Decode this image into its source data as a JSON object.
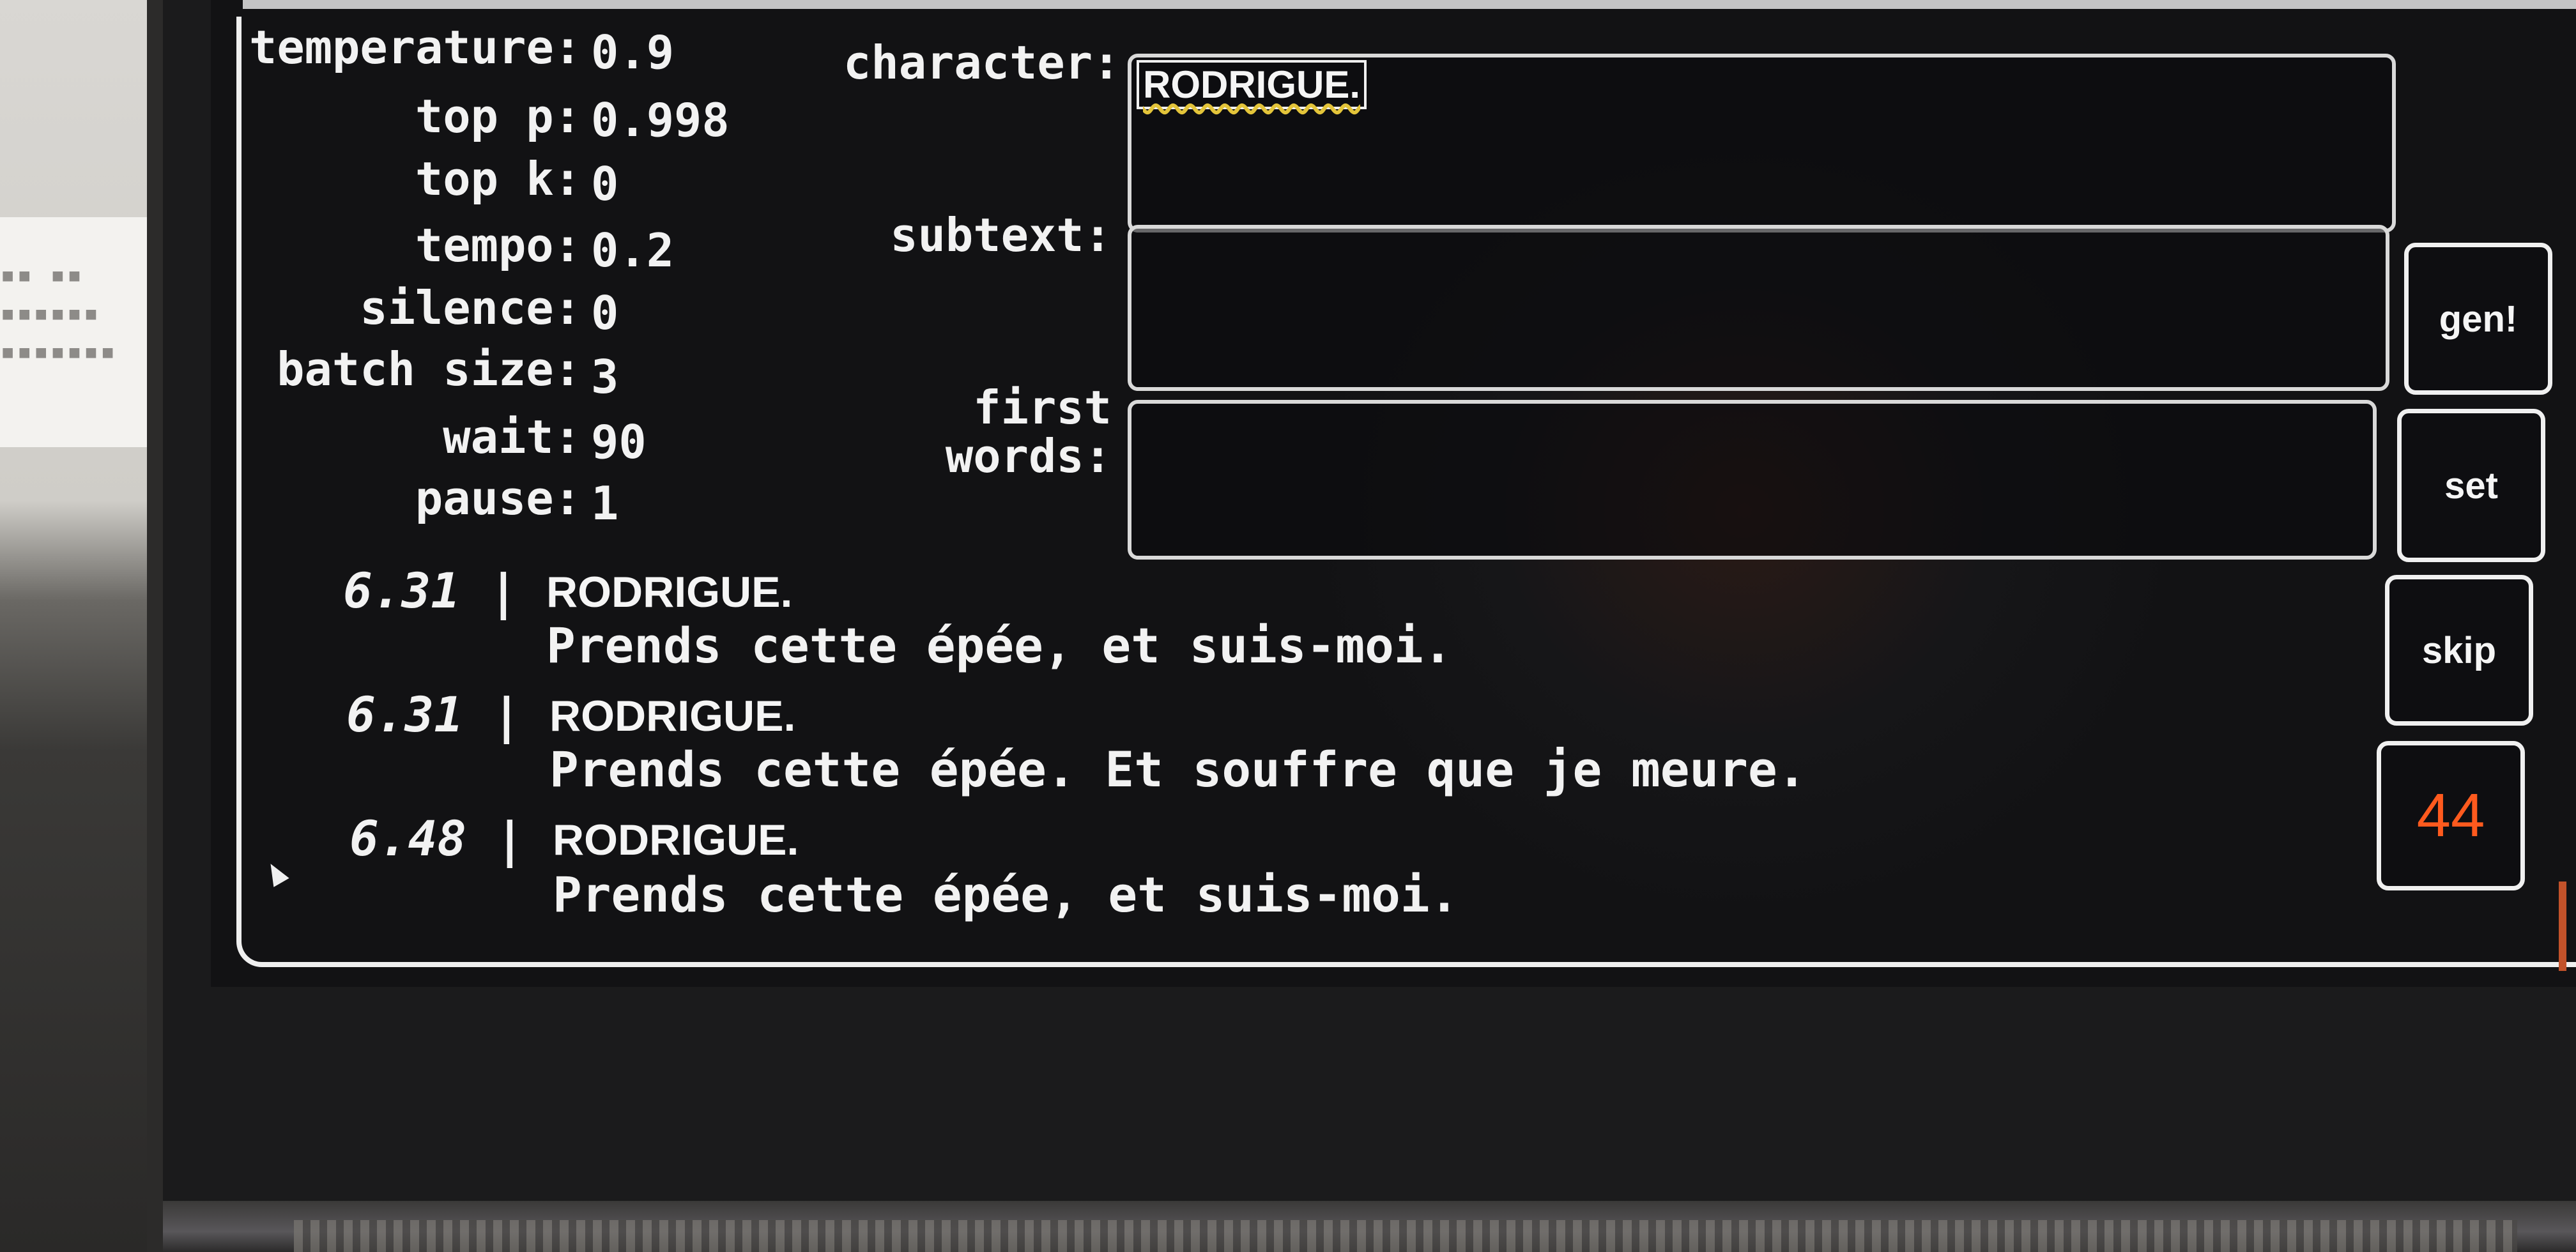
{
  "params": [
    {
      "label": "temperature:",
      "value": "0.9"
    },
    {
      "label": "top p:",
      "value": "0.998"
    },
    {
      "label": "top k:",
      "value": "0"
    },
    {
      "label": "tempo:",
      "value": "0.2"
    },
    {
      "label": "silence:",
      "value": "0"
    },
    {
      "label": "batch size:",
      "value": "3"
    },
    {
      "label": "wait:",
      "value": "90"
    },
    {
      "label": "pause:",
      "value": "1"
    }
  ],
  "fields": {
    "character": {
      "label": "character:",
      "value": "RODRIGUE."
    },
    "subtext": {
      "label": "subtext:",
      "value": ""
    },
    "first_words": {
      "label_line1": "first",
      "label_line2": "words:",
      "value": ""
    }
  },
  "buttons": {
    "gen": "gen!",
    "set": "set",
    "skip": "skip",
    "counter": "44"
  },
  "results": [
    {
      "score": "6.31",
      "sep": "|",
      "character": "RODRIGUE.",
      "text": "Prends cette épée, et suis-moi."
    },
    {
      "score": "6.31",
      "sep": "|",
      "character": "RODRIGUE.",
      "text": "Prends cette épée. Et souffre que je meure."
    },
    {
      "score": "6.48",
      "sep": "|",
      "character": "RODRIGUE.",
      "text": "Prends cette épée, et suis-moi."
    }
  ],
  "colors": {
    "accent": "#ff5a1e",
    "text": "#f2f2f2",
    "background": "#141416"
  }
}
